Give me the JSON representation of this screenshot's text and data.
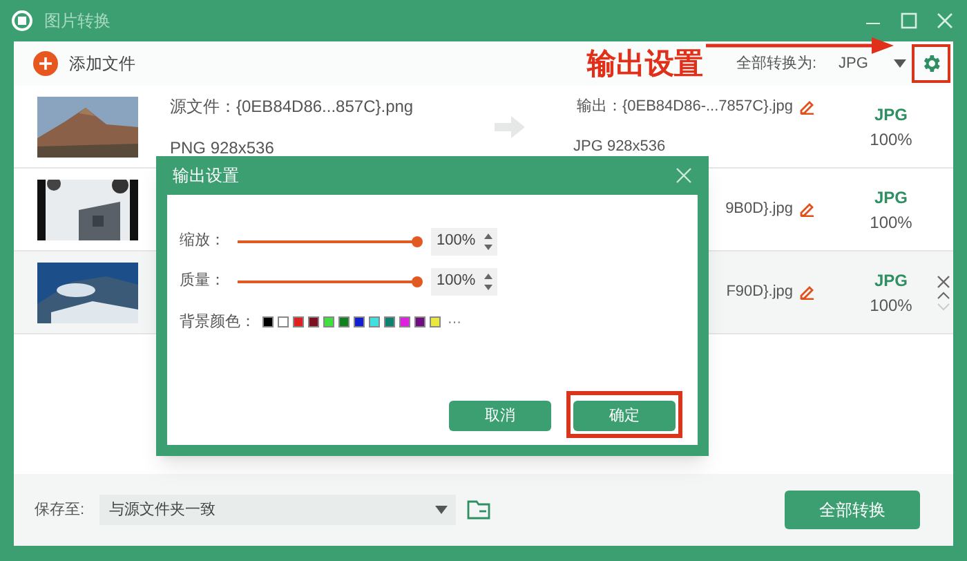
{
  "window": {
    "title": "图片转换"
  },
  "toolbar": {
    "add_button": "添加文件",
    "convert_all_label": "全部转换为:",
    "convert_all_format": "JPG",
    "settings_annotated": true
  },
  "callout": {
    "text": "输出设置"
  },
  "files": [
    {
      "source": "源文件：{0EB84D86...857C}.png",
      "source_info": "PNG  928x536",
      "output": "输出：{0EB84D86-...7857C}.jpg",
      "output_info": "JPG  928x536",
      "format": "JPG",
      "quality": "100%",
      "selected": false
    },
    {
      "output": "9B0D}.jpg",
      "format": "JPG",
      "quality": "100%",
      "selected": false
    },
    {
      "output": "F90D}.jpg",
      "format": "JPG",
      "quality": "100%",
      "selected": true
    }
  ],
  "dialog": {
    "title": "输出设置",
    "sliders": [
      {
        "label": "缩放：",
        "level": 1,
        "value": "100%"
      },
      {
        "label": "质量：",
        "level": 1,
        "value": "100%"
      }
    ],
    "background_label": "背景颜色：",
    "colors": [
      {
        "color": "#000000"
      },
      {
        "color": "#ffffff"
      },
      {
        "color": "#e02020"
      },
      {
        "color": "#7a1020"
      },
      {
        "color": "#40e040"
      },
      {
        "color": "#108020"
      },
      {
        "color": "#1020d0"
      },
      {
        "color": "#40e0e0"
      },
      {
        "color": "#108070"
      },
      {
        "color": "#e020e0"
      },
      {
        "color": "#701080"
      },
      {
        "color": "#e8e840"
      }
    ],
    "more": "···",
    "buttons": [
      {
        "label": "取消",
        "annotated": false
      },
      {
        "label": "确定",
        "annotated": true
      }
    ]
  },
  "footer": {
    "save_label": "保存至:",
    "save_path": "与源文件夹一致",
    "convert_button": "全部转换"
  }
}
